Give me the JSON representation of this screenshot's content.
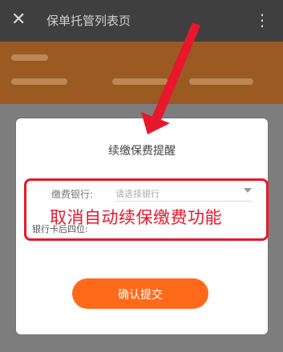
{
  "header": {
    "close_glyph": "✕",
    "title": "保单托管列表页",
    "more_glyph": "⋮"
  },
  "dialog": {
    "title": "续缴保费提醒",
    "bank_label": "缴费银行:",
    "bank_placeholder": "请选择银行",
    "sub_label": "银行卡后四位:",
    "confirm_label": "确认提交"
  },
  "annotation": {
    "text": "取消自动续保缴费功能"
  },
  "colors": {
    "accent": "#ff6a1a",
    "annotation_red": "#e8172b"
  }
}
